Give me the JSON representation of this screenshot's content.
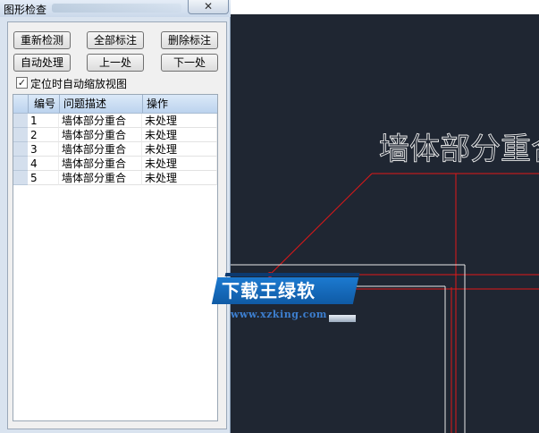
{
  "dialog": {
    "title": "图形检查",
    "close_glyph": "✕",
    "buttons": {
      "recheck": "重新检测",
      "mark_all": "全部标注",
      "delete_marks": "删除标注",
      "auto_process": "自动处理",
      "previous": "上一处",
      "next": "下一处"
    },
    "auto_zoom": {
      "label": "定位时自动缩放视图",
      "checked": true,
      "check_glyph": "✓"
    },
    "table": {
      "columns": [
        "编号",
        "问题描述",
        "操作"
      ],
      "rows": [
        {
          "id": "1",
          "desc": "墙体部分重合",
          "op": "未处理"
        },
        {
          "id": "2",
          "desc": "墙体部分重合",
          "op": "未处理"
        },
        {
          "id": "3",
          "desc": "墙体部分重合",
          "op": "未处理"
        },
        {
          "id": "4",
          "desc": "墙体部分重合",
          "op": "未处理"
        },
        {
          "id": "5",
          "desc": "墙体部分重合",
          "op": "未处理"
        }
      ]
    }
  },
  "cad": {
    "label": "墙体部分重合",
    "background": "#1f2632",
    "line_color": "#e01818",
    "wall_color": "#e8e8e8"
  },
  "watermark": {
    "text": "下载王绿软",
    "url": "www.xzking.com"
  }
}
